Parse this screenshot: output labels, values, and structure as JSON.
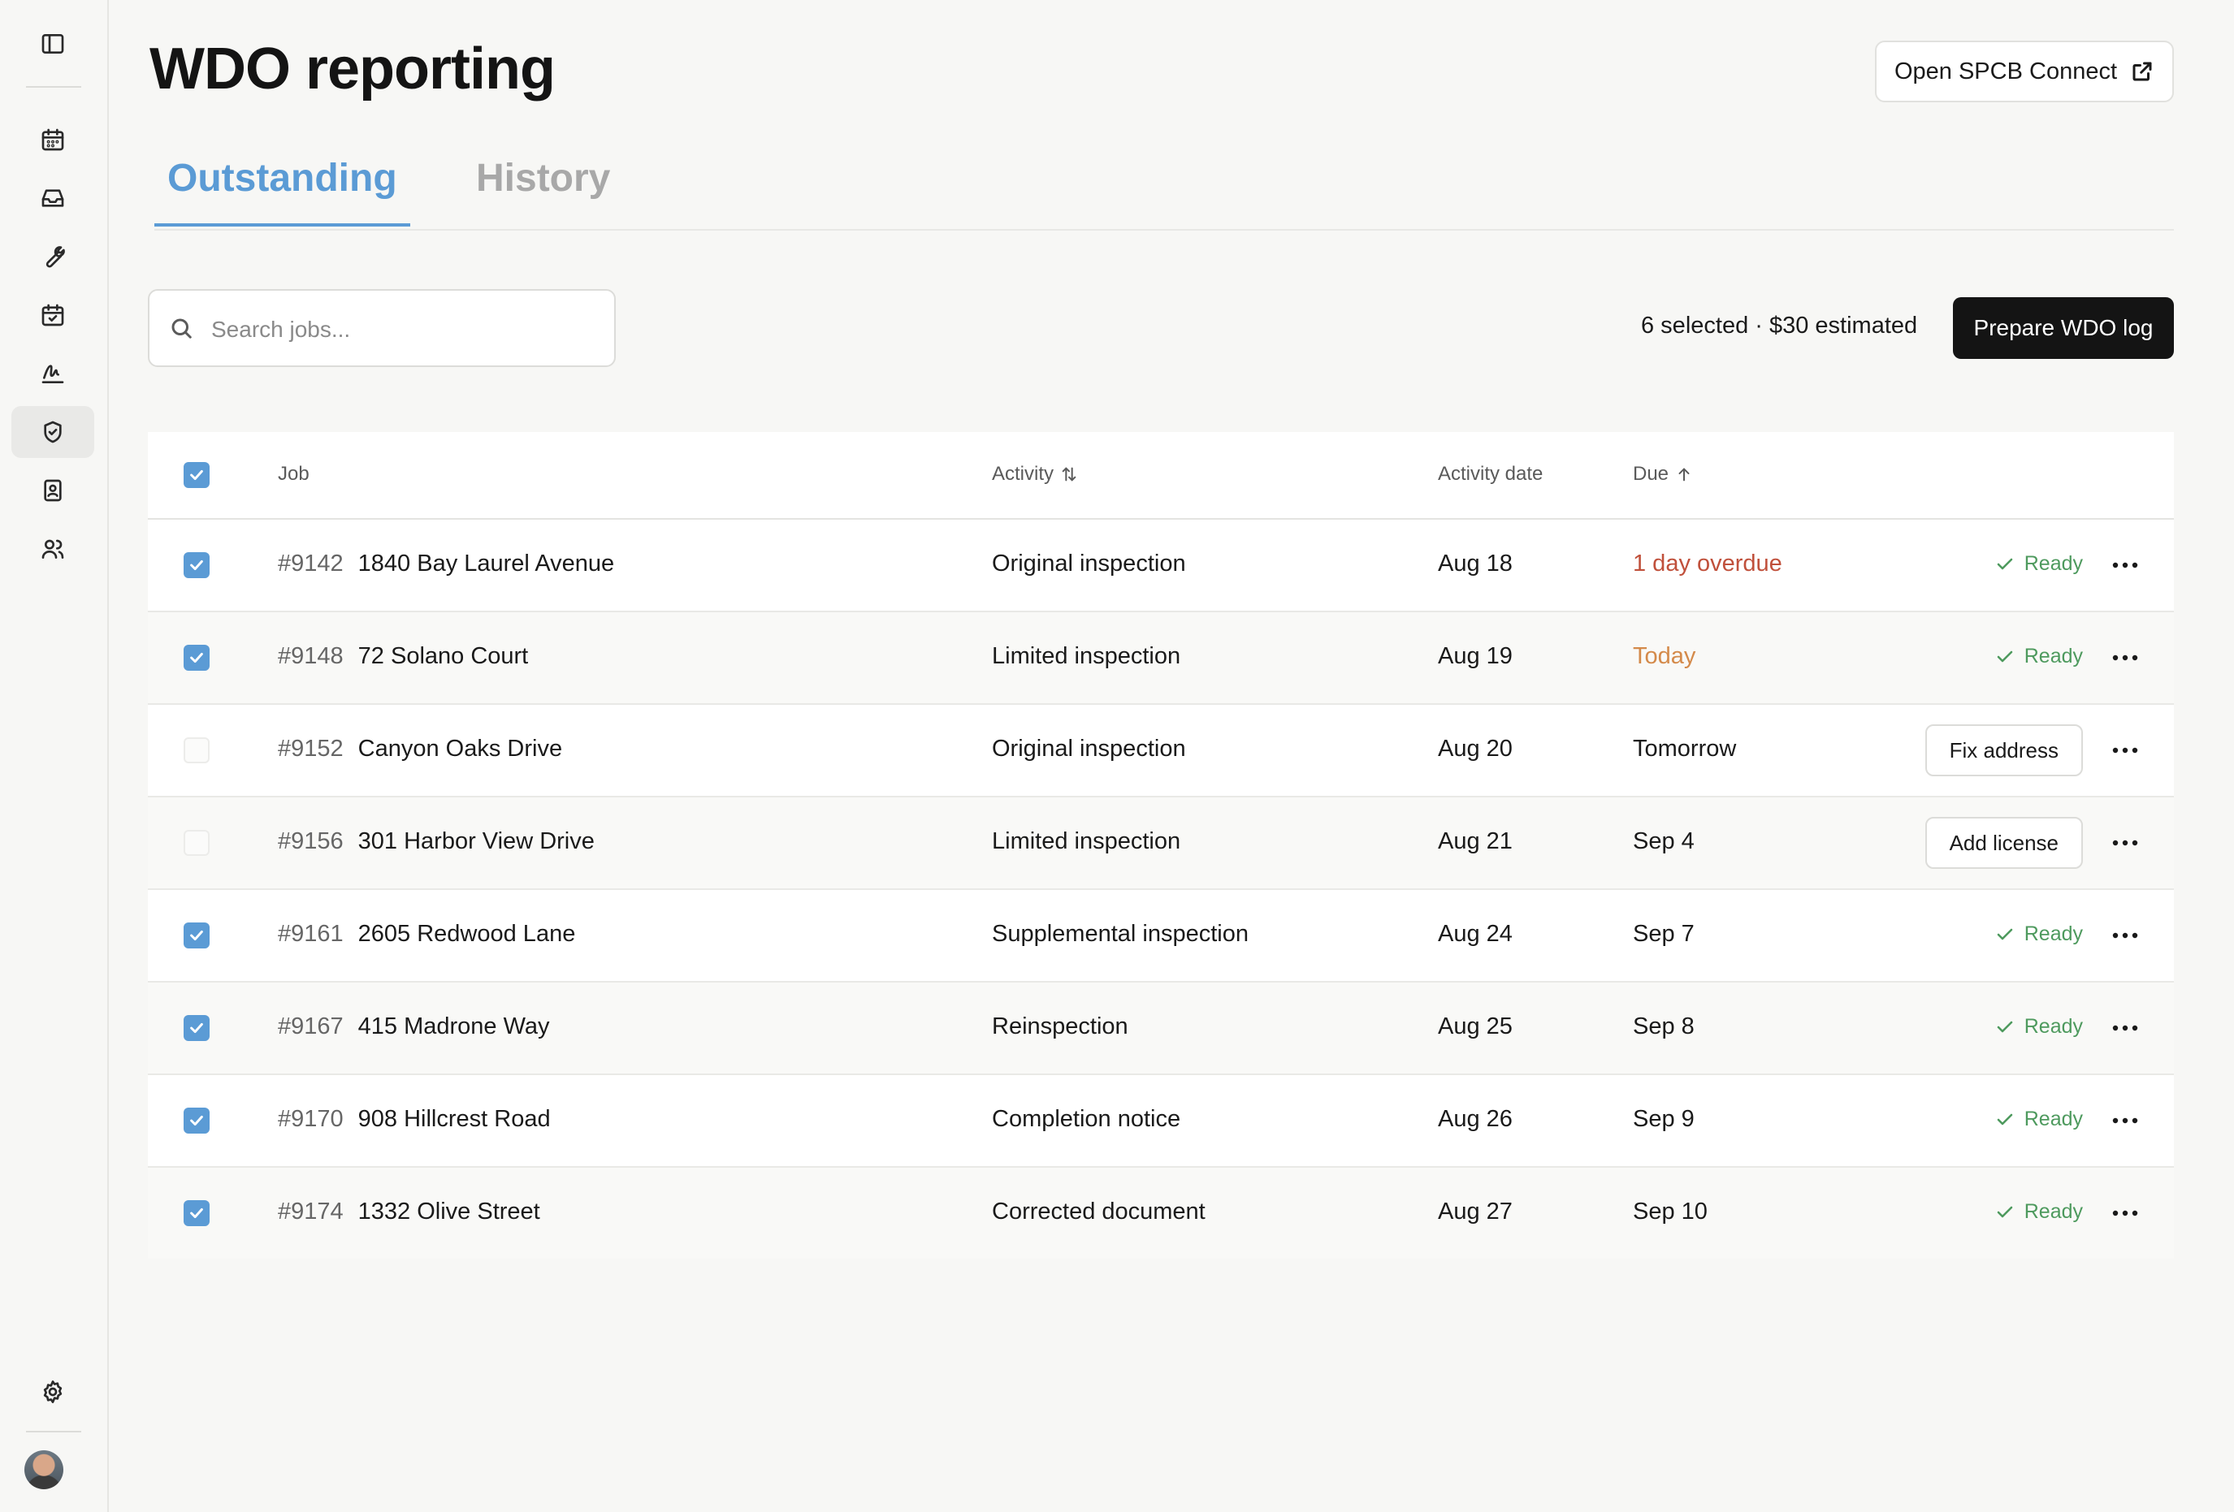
{
  "page": {
    "title": "WDO reporting",
    "connect_button": "Open SPCB Connect"
  },
  "sidebar": {
    "items": [
      {
        "icon": "sidebar-toggle-icon"
      },
      {
        "icon": "calendar-icon"
      },
      {
        "icon": "inbox-icon"
      },
      {
        "icon": "wrench-icon"
      },
      {
        "icon": "calendar-check-icon"
      },
      {
        "icon": "signature-icon"
      },
      {
        "icon": "shield-check-icon",
        "active": true
      },
      {
        "icon": "contact-book-icon"
      },
      {
        "icon": "users-icon"
      },
      {
        "icon": "gear-icon"
      }
    ]
  },
  "tabs": [
    {
      "label": "Outstanding",
      "active": true
    },
    {
      "label": "History",
      "active": false
    }
  ],
  "toolbar": {
    "search_placeholder": "Search jobs...",
    "selection_summary": "6 selected · $30 estimated",
    "prepare_button": "Prepare WDO log"
  },
  "table": {
    "headers": {
      "job": "Job",
      "activity": "Activity",
      "activity_date": "Activity date",
      "due": "Due"
    },
    "rows": [
      {
        "id": "#9142",
        "address": "1840 Bay Laurel Avenue",
        "activity": "Original inspection",
        "date": "Aug 18",
        "due": "1 day overdue",
        "due_style": "overdue",
        "checked": true,
        "status": "Ready",
        "action": ""
      },
      {
        "id": "#9148",
        "address": "72 Solano Court",
        "activity": "Limited inspection",
        "date": "Aug 19",
        "due": "Today",
        "due_style": "today",
        "checked": true,
        "status": "Ready",
        "action": ""
      },
      {
        "id": "#9152",
        "address": "Canyon Oaks Drive",
        "activity": "Original inspection",
        "date": "Aug 20",
        "due": "Tomorrow",
        "due_style": "normal",
        "checked": false,
        "status": "",
        "action": "Fix address"
      },
      {
        "id": "#9156",
        "address": "301 Harbor View Drive",
        "activity": "Limited inspection",
        "date": "Aug 21",
        "due": "Sep 4",
        "due_style": "normal",
        "checked": false,
        "status": "",
        "action": "Add license"
      },
      {
        "id": "#9161",
        "address": "2605 Redwood Lane",
        "activity": "Supplemental inspection",
        "date": "Aug 24",
        "due": "Sep 7",
        "due_style": "normal",
        "checked": true,
        "status": "Ready",
        "action": ""
      },
      {
        "id": "#9167",
        "address": "415 Madrone Way",
        "activity": "Reinspection",
        "date": "Aug 25",
        "due": "Sep 8",
        "due_style": "normal",
        "checked": true,
        "status": "Ready",
        "action": ""
      },
      {
        "id": "#9170",
        "address": "908 Hillcrest Road",
        "activity": "Completion notice",
        "date": "Aug 26",
        "due": "Sep 9",
        "due_style": "normal",
        "checked": true,
        "status": "Ready",
        "action": ""
      },
      {
        "id": "#9174",
        "address": "1332 Olive Street",
        "activity": "Corrected document",
        "date": "Aug 27",
        "due": "Sep 10",
        "due_style": "normal",
        "checked": true,
        "status": "Ready",
        "action": ""
      }
    ]
  },
  "colors": {
    "accent": "#5b9bd5",
    "overdue": "#c0503b",
    "today": "#d48a4a",
    "ready": "#4e9a5e",
    "primary_button": "#141414"
  }
}
